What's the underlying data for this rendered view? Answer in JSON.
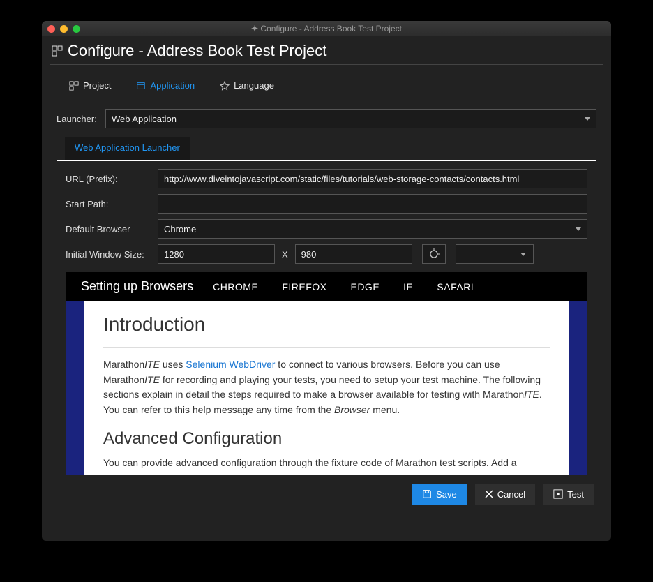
{
  "titlebar": {
    "title": "Configure - Address Book Test Project"
  },
  "header": {
    "title": "Configure - Address Book Test Project"
  },
  "tabs": {
    "project": "Project",
    "application": "Application",
    "language": "Language"
  },
  "launcher": {
    "label": "Launcher:",
    "value": "Web Application"
  },
  "subtabs": {
    "web_launcher": "Web Application Launcher"
  },
  "fields": {
    "url_prefix_label": "URL (Prefix):",
    "url_prefix_value": "http://www.diveintojavascript.com/static/files/tutorials/web-storage-contacts/contacts.html",
    "start_path_label": "Start Path:",
    "start_path_value": "",
    "default_browser_label": "Default Browser",
    "default_browser_value": "Chrome",
    "window_size_label": "Initial Window Size:",
    "window_w": "1280",
    "window_sep": "X",
    "window_h": "980"
  },
  "browser_bar": {
    "heading": "Setting up Browsers",
    "items": [
      "CHROME",
      "FIREFOX",
      "EDGE",
      "IE",
      "SAFARI"
    ]
  },
  "doc": {
    "h1": "Introduction",
    "p1a": "Marathon",
    "p1b": "ITE",
    "p1c": " uses ",
    "p1link": "Selenium WebDriver",
    "p1d": " to connect to various browsers. Before you can use Marathon",
    "p1e": "ITE",
    "p1f": " for recording and playing your tests, you need to setup your test machine. The following sections explain in detail the steps required to make a browser available for testing with Marathon",
    "p1g": "ITE",
    "p1h": ". You can refer to this help message any time from the ",
    "p1i": "Browser",
    "p1j": " menu.",
    "h2": "Advanced Configuration",
    "p2": "You can provide advanced configuration through the fixture code of Marathon test scripts. Add a"
  },
  "buttons": {
    "save": "Save",
    "cancel": "Cancel",
    "test": "Test"
  }
}
